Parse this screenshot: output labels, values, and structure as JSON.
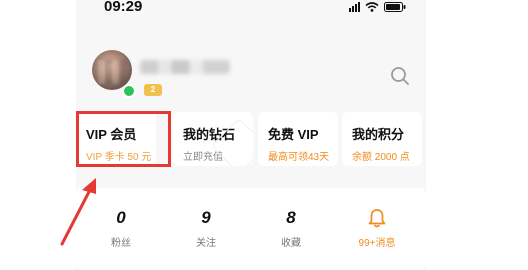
{
  "status_bar": {
    "time": "09:29"
  },
  "profile": {
    "level": "2"
  },
  "cards": [
    {
      "title": "VIP 会员",
      "subtitle": "VIP 季卡 50 元",
      "subtitle_color": "#f0a040"
    },
    {
      "title": "我的钻石",
      "subtitle": "立即充值",
      "subtitle_color": "#888888"
    },
    {
      "title": "免费 VIP",
      "subtitle": "最高可领43天",
      "subtitle_color": "#f08c1f"
    },
    {
      "title": "我的积分",
      "subtitle": "余额 2000 点",
      "subtitle_color": "#f08c1f"
    }
  ],
  "stats": [
    {
      "value": "0",
      "label": "粉丝"
    },
    {
      "value": "9",
      "label": "关注"
    },
    {
      "value": "8",
      "label": "收藏"
    },
    {
      "label": "99+消息"
    }
  ],
  "colors": {
    "accent": "#f08c1f",
    "highlight": "#e53a34",
    "online": "#2ec25b"
  },
  "icons": [
    "search-icon",
    "bell-icon",
    "signal-icon",
    "wifi-icon",
    "battery-icon"
  ]
}
